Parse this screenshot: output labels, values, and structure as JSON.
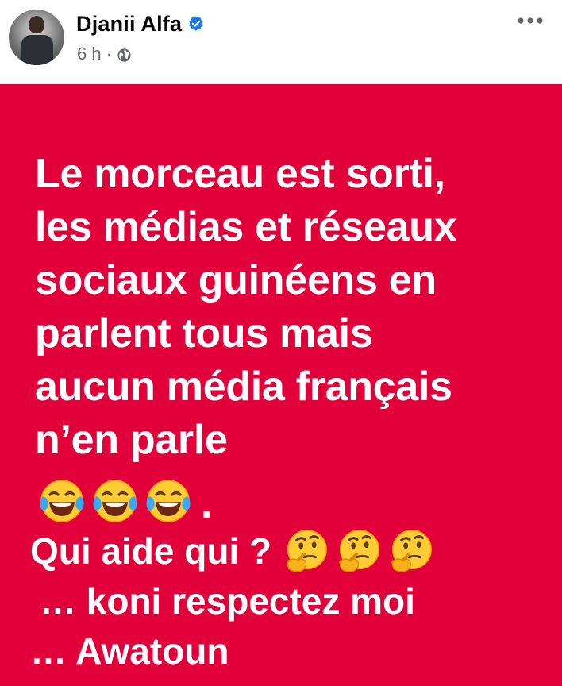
{
  "post": {
    "author": "Djanii Alfa",
    "time": "6 h",
    "separator": "·",
    "verified": true,
    "privacy_icon": "globe-icon",
    "more_icon": "more-dots-icon",
    "background_color": "#e1003a",
    "text_color": "#ffffff"
  },
  "content": {
    "lines": [
      "Le morceau est sorti,",
      "les médias et réseaux",
      "sociaux guinéens en",
      "parlent tous mais",
      "aucun média français",
      "n’en parle"
    ],
    "emoji_line": {
      "emojis": [
        "tears-of-joy-emoji",
        "tears-of-joy-emoji",
        "tears-of-joy-emoji"
      ],
      "trailing": "."
    },
    "question": {
      "text": "Qui aide qui ?",
      "emojis": [
        "thinking-face-emoji",
        "thinking-face-emoji",
        "thinking-face-emoji"
      ]
    },
    "line_koni": "… koni respectez moi",
    "line_awatoun": "… Awatoun"
  }
}
